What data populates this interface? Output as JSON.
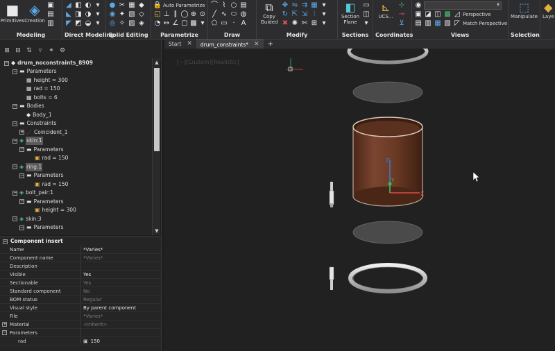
{
  "ribbon": {
    "groups": [
      {
        "label": "Modeling",
        "buttons": [
          "Primitives",
          "Creation"
        ]
      },
      {
        "label": "Direct Modeling"
      },
      {
        "label": "Solid Editing"
      },
      {
        "label": "Parametrize",
        "auto_label": "Auto Parametrize"
      },
      {
        "label": "Draw"
      },
      {
        "label": "Modify",
        "copy_guided": "Copy Guided"
      },
      {
        "label": "Sections",
        "section_plane": "Section Plane"
      },
      {
        "label": "Coordinates",
        "ucs": "UCS..."
      },
      {
        "label": "Views",
        "perspective": "Perspective",
        "match_perspective": "Match Perspective",
        "view_select": ""
      },
      {
        "label": "Selection",
        "manipulate": "Manipulate",
        "layers": "Laye"
      }
    ]
  },
  "tree": {
    "root": "drum_noconstraints_8909",
    "rows": [
      {
        "label": "Parameters",
        "level": 1,
        "type": "folder",
        "toggle": "−"
      },
      {
        "label": "height = 300",
        "level": 2,
        "type": "param",
        "toggle": ""
      },
      {
        "label": "rad = 150",
        "level": 2,
        "type": "param",
        "toggle": ""
      },
      {
        "label": "bolts = 6",
        "level": 2,
        "type": "param",
        "toggle": ""
      },
      {
        "label": "Bodies",
        "level": 1,
        "type": "folder",
        "toggle": "−"
      },
      {
        "label": "Body_1",
        "level": 2,
        "type": "body",
        "toggle": ""
      },
      {
        "label": "Constraints",
        "level": 1,
        "type": "folder",
        "toggle": "−"
      },
      {
        "label": "Coincident_1",
        "level": 2,
        "type": "constraint",
        "toggle": "+"
      },
      {
        "label": "skin:1",
        "level": 1,
        "type": "component",
        "toggle": "−",
        "selected": true
      },
      {
        "label": "Parameters",
        "level": 2,
        "type": "folder",
        "toggle": "−"
      },
      {
        "label": "rad = 150",
        "level": 3,
        "type": "lockparam",
        "toggle": ""
      },
      {
        "label": "ring:1",
        "level": 1,
        "type": "component",
        "toggle": "−",
        "selected": true
      },
      {
        "label": "Parameters",
        "level": 2,
        "type": "folder",
        "toggle": "−"
      },
      {
        "label": "rad = 150",
        "level": 3,
        "type": "lockparam",
        "toggle": ""
      },
      {
        "label": "bolt_pair:1",
        "level": 1,
        "type": "component",
        "toggle": "−"
      },
      {
        "label": "Parameters",
        "level": 2,
        "type": "folder",
        "toggle": "−"
      },
      {
        "label": "height = 300",
        "level": 3,
        "type": "lockparam",
        "toggle": ""
      },
      {
        "label": "skin:3",
        "level": 1,
        "type": "component",
        "toggle": "−"
      },
      {
        "label": "Parameters",
        "level": 2,
        "type": "folder",
        "toggle": "−"
      }
    ]
  },
  "properties": {
    "title": "Component insert",
    "rows": [
      {
        "key": "Name",
        "value": "*Varies*",
        "dim": false
      },
      {
        "key": "Component name",
        "value": "*Varies*",
        "dim": true
      },
      {
        "key": "Description",
        "value": "",
        "dim": false
      },
      {
        "key": "Visible",
        "value": "Yes",
        "dim": false
      },
      {
        "key": "Sectionable",
        "value": "Yes",
        "dim": true
      },
      {
        "key": "Standard component",
        "value": "No",
        "dim": true
      },
      {
        "key": "BOM status",
        "value": "Regular",
        "dim": true
      },
      {
        "key": "Visual style",
        "value": "By parent component",
        "dim": false
      },
      {
        "key": "File",
        "value": "*Varies*",
        "dim": true
      },
      {
        "key": "Material",
        "value": "<Inherit>",
        "dim": true,
        "toggle": "+"
      },
      {
        "key": "Parameters",
        "value": "",
        "dim": false,
        "toggle": "−"
      },
      {
        "key": "rad",
        "value": "150",
        "dim": false,
        "lock": true
      }
    ]
  },
  "tabs": {
    "items": [
      {
        "label": "Start",
        "active": false
      },
      {
        "label": "drum_constraints*",
        "active": true
      }
    ]
  },
  "viewport": {
    "view_label": "[−][Custom][Realistic]",
    "axis_labels": {
      "x": "X",
      "y": "Y",
      "z": "Z"
    },
    "colors": {
      "drum": "#6b3a24",
      "disk": "#4a4a4a",
      "ring": "#bdbdbd"
    }
  }
}
